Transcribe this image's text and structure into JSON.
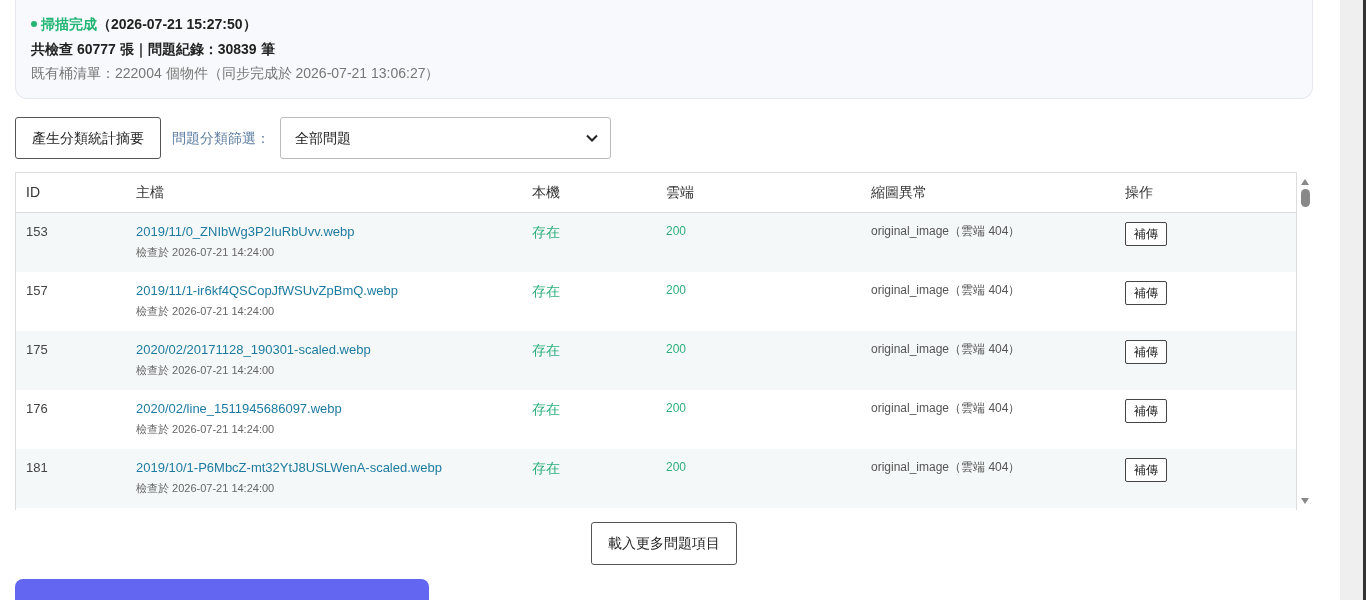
{
  "scan_status": {
    "complete": true,
    "label": "掃描完成",
    "time": "（2026-07-21 15:27:50）",
    "summary": "共檢查 60777 張｜問題紀錄：30839 筆",
    "bucket_info": "既有桶清單：222004 個物件（同步完成於 2026-07-21 13:06:27）"
  },
  "toolbar": {
    "summary_button": "產生分類統計摘要",
    "filter_label": "問題分類篩選：",
    "filter_value": "全部問題"
  },
  "table": {
    "columns": [
      "ID",
      "主檔",
      "本機",
      "雲端",
      "縮圖異常",
      "操作"
    ],
    "rows": [
      {
        "id": "153",
        "file": "2019/11/0_ZNIbWg3P2IuRbUvv.webp",
        "checked_at": "檢查於 2026-07-21 14:24:00",
        "local": "存在",
        "cloud": "200",
        "thumbnail_issue": "original_image（雲端 404）",
        "action": "補傳"
      },
      {
        "id": "157",
        "file": "2019/11/1-ir6kf4QSCopJfWSUvZpBmQ.webp",
        "checked_at": "檢查於 2026-07-21 14:24:00",
        "local": "存在",
        "cloud": "200",
        "thumbnail_issue": "original_image（雲端 404）",
        "action": "補傳"
      },
      {
        "id": "175",
        "file": "2020/02/20171128_190301-scaled.webp",
        "checked_at": "檢查於 2026-07-21 14:24:00",
        "local": "存在",
        "cloud": "200",
        "thumbnail_issue": "original_image（雲端 404）",
        "action": "補傳"
      },
      {
        "id": "176",
        "file": "2020/02/line_1511945686097.webp",
        "checked_at": "檢查於 2026-07-21 14:24:00",
        "local": "存在",
        "cloud": "200",
        "thumbnail_issue": "original_image（雲端 404）",
        "action": "補傳"
      },
      {
        "id": "181",
        "file": "2019/10/1-P6MbcZ-mt32YtJ8USLWenA-scaled.webp",
        "checked_at": "檢查於 2026-07-21 14:24:00",
        "local": "存在",
        "cloud": "200",
        "thumbnail_issue": "original_image（雲端 404）",
        "action": "補傳"
      }
    ]
  },
  "load_more_button": "載入更多問題項目"
}
